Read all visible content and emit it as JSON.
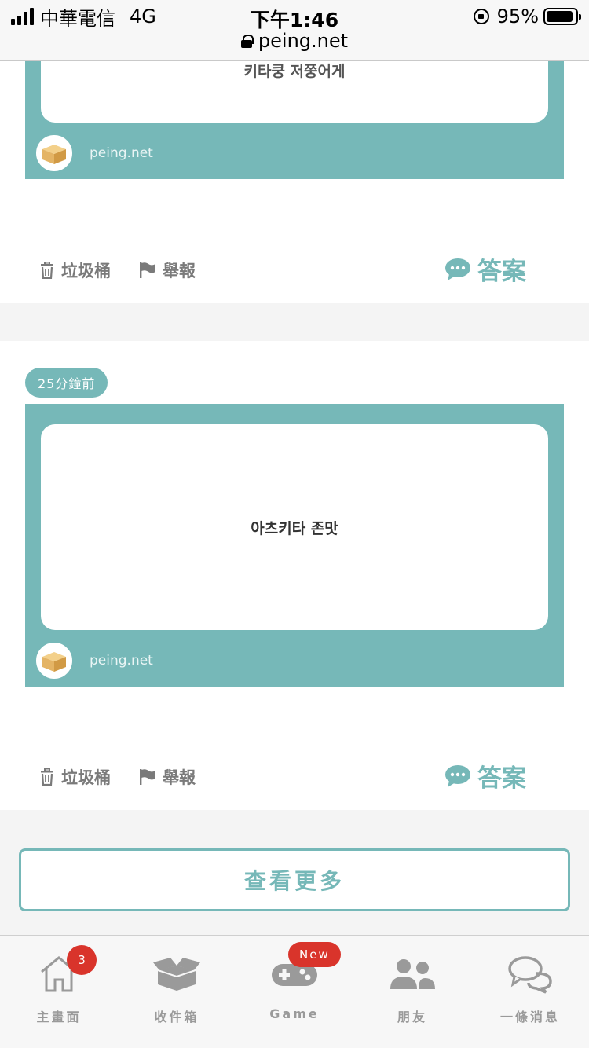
{
  "status": {
    "carrier": "中華電信",
    "network": "4G",
    "time": "下午1:46",
    "battery": "95%",
    "url": "peing.net"
  },
  "cards": [
    {
      "question": "키타쿵 저쭝어게",
      "site": "peing.net",
      "trash_label": "垃圾桶",
      "report_label": "舉報",
      "answer_label": "答案"
    },
    {
      "time_tag": "25分鐘前",
      "question": "아츠키타 존맛",
      "site": "peing.net",
      "trash_label": "垃圾桶",
      "report_label": "舉報",
      "answer_label": "答案"
    }
  ],
  "more_button": "查看更多",
  "tabs": [
    {
      "label": "主畫面",
      "icon": "home-icon",
      "badge": "3"
    },
    {
      "label": "收件箱",
      "icon": "inbox-box-icon"
    },
    {
      "label": "Game",
      "icon": "gamepad-icon",
      "badge": "New"
    },
    {
      "label": "朋友",
      "icon": "friends-icon"
    },
    {
      "label": "一條消息",
      "icon": "chat-bubbles-icon"
    }
  ],
  "colors": {
    "accent": "#76b8b8",
    "badge": "#d9342b",
    "icon_gray": "#9a9a9a"
  }
}
